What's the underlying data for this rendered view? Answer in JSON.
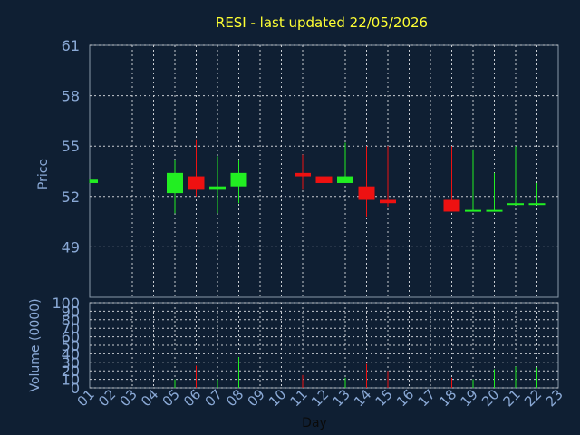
{
  "title": "RESI - last updated 22/05/2026",
  "colors": {
    "background": "#0f1f33",
    "title": "#ffff33",
    "axis_text": "#8aa9d6",
    "up": "#22ee22",
    "down": "#ee1111",
    "grid": "#c8ccd2"
  },
  "chart_data": [
    {
      "type": "candlestick",
      "ylabel": "Price",
      "ylim": [
        46,
        61
      ],
      "yticks": [
        "61",
        "58",
        "55",
        "52",
        "49"
      ],
      "ytick_values": [
        61,
        58,
        55,
        52,
        49
      ],
      "grid": true,
      "candles": [
        {
          "day": "01",
          "open": 52.8,
          "close": 53.0,
          "high": 53.0,
          "low": 52.8
        },
        {
          "day": "05",
          "open": 52.2,
          "close": 53.4,
          "high": 54.2,
          "low": 51.0
        },
        {
          "day": "06",
          "open": 53.2,
          "close": 52.4,
          "high": 55.4,
          "low": 52.0
        },
        {
          "day": "07",
          "open": 52.4,
          "close": 52.6,
          "high": 54.4,
          "low": 51.0
        },
        {
          "day": "08",
          "open": 52.6,
          "close": 53.4,
          "high": 54.2,
          "low": 51.6
        },
        {
          "day": "11",
          "open": 53.4,
          "close": 53.2,
          "high": 54.5,
          "low": 52.4
        },
        {
          "day": "12",
          "open": 53.2,
          "close": 52.8,
          "high": 55.6,
          "low": 52.0
        },
        {
          "day": "13",
          "open": 52.8,
          "close": 53.2,
          "high": 55.2,
          "low": 52.8
        },
        {
          "day": "14",
          "open": 52.6,
          "close": 51.8,
          "high": 55.0,
          "low": 50.8
        },
        {
          "day": "15",
          "open": 51.8,
          "close": 51.6,
          "high": 55.0,
          "low": 51.4
        },
        {
          "day": "18",
          "open": 51.8,
          "close": 51.1,
          "high": 55.0,
          "low": 51.1
        },
        {
          "day": "19",
          "open": 51.1,
          "close": 51.2,
          "high": 54.8,
          "low": 51.1
        },
        {
          "day": "20",
          "open": 51.1,
          "close": 51.2,
          "high": 53.4,
          "low": 51.1
        },
        {
          "day": "21",
          "open": 51.5,
          "close": 51.6,
          "high": 55.0,
          "low": 51.5
        },
        {
          "day": "22",
          "open": 51.5,
          "close": 51.6,
          "high": 52.8,
          "low": 51.5
        }
      ]
    },
    {
      "type": "bar",
      "ylabel": "Volume (0000)",
      "ylim": [
        0,
        100
      ],
      "yticks": [
        "100",
        "90",
        "80",
        "70",
        "60",
        "50",
        "40",
        "30",
        "20",
        "10",
        "0"
      ],
      "ytick_values": [
        100,
        90,
        80,
        70,
        60,
        50,
        40,
        30,
        20,
        10,
        0
      ],
      "xlabel": "Day",
      "categories": [
        "01",
        "02",
        "03",
        "04",
        "05",
        "06",
        "07",
        "08",
        "09",
        "10",
        "11",
        "12",
        "13",
        "14",
        "15",
        "16",
        "17",
        "18",
        "19",
        "20",
        "21",
        "22",
        "23"
      ],
      "bars": [
        {
          "day": "05",
          "value": 10,
          "direction": "up"
        },
        {
          "day": "06",
          "value": 26,
          "direction": "down"
        },
        {
          "day": "07",
          "value": 10,
          "direction": "up"
        },
        {
          "day": "08",
          "value": 36,
          "direction": "up"
        },
        {
          "day": "11",
          "value": 15,
          "direction": "down"
        },
        {
          "day": "12",
          "value": 88,
          "direction": "down"
        },
        {
          "day": "13",
          "value": 12,
          "direction": "up"
        },
        {
          "day": "14",
          "value": 28,
          "direction": "down"
        },
        {
          "day": "15",
          "value": 20,
          "direction": "down"
        },
        {
          "day": "18",
          "value": 12,
          "direction": "down"
        },
        {
          "day": "19",
          "value": 10,
          "direction": "up"
        },
        {
          "day": "20",
          "value": 22,
          "direction": "up"
        },
        {
          "day": "21",
          "value": 25,
          "direction": "up"
        },
        {
          "day": "22",
          "value": 24,
          "direction": "up"
        }
      ]
    }
  ]
}
